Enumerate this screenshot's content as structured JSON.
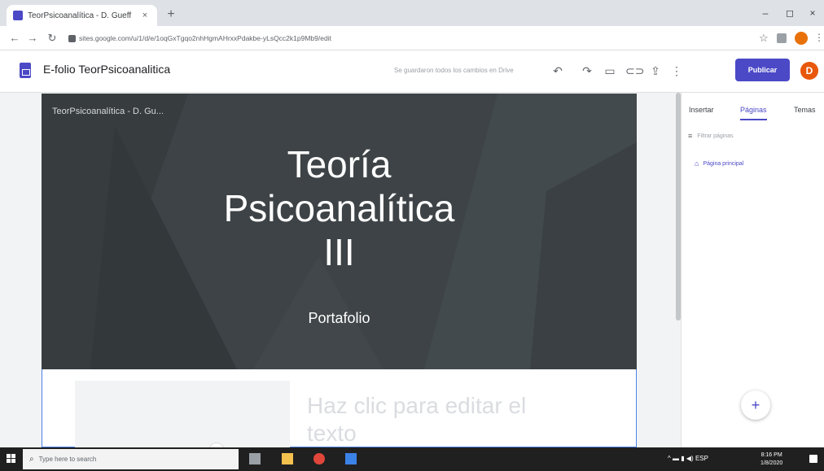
{
  "browser": {
    "tab_title": "TeorPsicoanalítica - D. Gueff",
    "tab_close": "×",
    "new_tab": "+",
    "url": "sites.google.com/u/1/d/e/1oqGxTgqo2nhHgmAHrxxPdakbe-yLsQcc2k1p9Mb9/edit",
    "window_minimize": "–",
    "window_maximize": "◻",
    "window_close": "×"
  },
  "header": {
    "site_title": "E-folio TeorPsicoanalitica",
    "save_status": "Se guardaron todos los cambios en Drive",
    "publish_label": "Publicar",
    "avatar_letter": "D"
  },
  "hero": {
    "nav_label": "TeorPsicoanalítica - D. Gu...",
    "title_line1": "Teoría",
    "title_line2": "Psicoanalítica",
    "title_line3": "III",
    "subtitle": "Portafolio"
  },
  "content": {
    "edit_text": "Haz clic para editar el texto"
  },
  "panel": {
    "tabs": [
      "Insertar",
      "Páginas",
      "Temas"
    ],
    "active_tab": "Páginas",
    "filter_placeholder": "Filtrar páginas",
    "page_item": "Página principal"
  },
  "taskbar": {
    "search_placeholder": "Type here to search",
    "clock_time": "8:16 PM",
    "clock_date": "1/8/2020",
    "lang": "ESP"
  },
  "colors": {
    "accent": "#4b49c6",
    "hero_bg": "#3d4346",
    "avatar": "#e8570a"
  }
}
